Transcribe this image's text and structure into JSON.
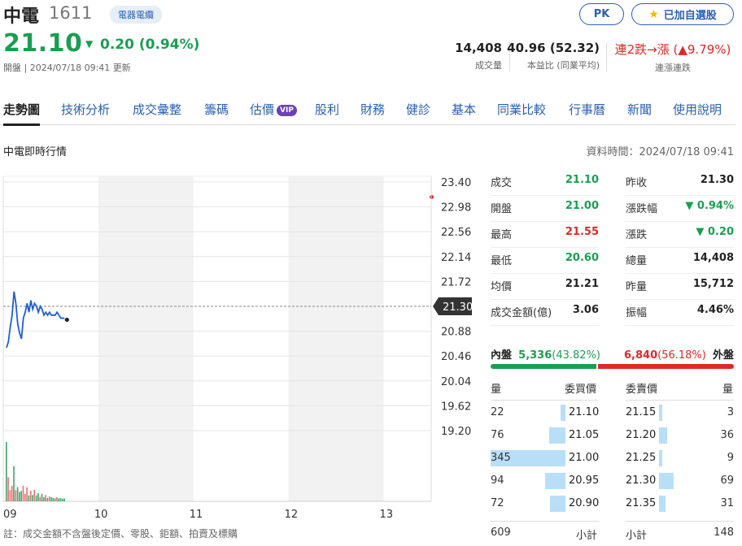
{
  "header": {
    "name": "中電",
    "code": "1611",
    "category": "電器電纜",
    "price": "21.10",
    "change_arrow": "▼",
    "change": "0.20 (0.94%)",
    "status": "開盤 | 2024/07/18 09:41 更新",
    "pk_button": "PK",
    "watchlist_icon": "star-icon",
    "watchlist_button": "已加自選股",
    "stats": [
      {
        "value": "14,408",
        "label": "成交量"
      },
      {
        "value": "40.96 (52.32)",
        "label": "本益比 (同業平均)"
      },
      {
        "value": "連2跌→漲 (▲9.79%)",
        "label": "連漲連跌"
      }
    ]
  },
  "tabs": [
    "走勢圖",
    "技術分析",
    "成交彙整",
    "籌碼",
    "估價",
    "股利",
    "財務",
    "健診",
    "基本",
    "同業比較",
    "行事曆",
    "新聞",
    "使用說明"
  ],
  "vip_badge": "VIP",
  "section": {
    "title": "中電即時行情",
    "data_time": "資料時間：2024/07/18 09:41"
  },
  "chart_data": {
    "type": "line",
    "y_ticks": [
      "23.40",
      "22.98",
      "22.56",
      "22.14",
      "21.72",
      "21.30",
      "20.88",
      "20.46",
      "20.04",
      "19.62",
      "19.20"
    ],
    "x_ticks": [
      "09",
      "10",
      "11",
      "12",
      "13"
    ],
    "ylim": [
      19.2,
      23.4
    ],
    "reference_price": "21.30",
    "last_price_point": 21.1,
    "price_series": [
      20.6,
      20.7,
      20.95,
      21.15,
      21.55,
      21.35,
      21.0,
      20.85,
      20.75,
      21.1,
      21.2,
      21.35,
      21.2,
      21.4,
      21.25,
      21.35,
      21.3,
      21.2,
      21.3,
      21.25,
      21.15,
      21.2,
      21.15,
      21.2,
      21.15,
      21.15,
      21.15,
      21.2,
      21.15,
      21.1,
      21.1,
      21.1
    ],
    "volume_series": [
      1600,
      650,
      300,
      420,
      950,
      300,
      380,
      250,
      280,
      420,
      200,
      380,
      160,
      290,
      170,
      310,
      160,
      220,
      120,
      200,
      110,
      170,
      90,
      130,
      110,
      90,
      80,
      110,
      80,
      90,
      70,
      80
    ],
    "volume_colors_up": [
      false,
      true,
      true,
      true,
      false,
      true,
      false,
      false,
      false,
      true,
      true,
      true,
      false,
      true,
      false,
      true,
      false,
      false,
      true,
      false,
      false,
      true,
      false,
      true,
      false,
      false,
      false,
      true,
      false,
      false,
      false,
      false
    ]
  },
  "quote": {
    "left": [
      {
        "label": "成交",
        "value": "21.10",
        "color": "green"
      },
      {
        "label": "開盤",
        "value": "21.00",
        "color": "green"
      },
      {
        "label": "最高",
        "value": "21.55",
        "color": "red"
      },
      {
        "label": "最低",
        "value": "20.60",
        "color": "green"
      },
      {
        "label": "均價",
        "value": "21.21",
        "color": "dark"
      },
      {
        "label": "成交金額(億)",
        "value": "3.06",
        "color": "dark"
      }
    ],
    "right": [
      {
        "label": "昨收",
        "value": "21.30",
        "color": "dark"
      },
      {
        "label": "漲跌幅",
        "value": "▼ 0.94%",
        "color": "green"
      },
      {
        "label": "漲跌",
        "value": "▼ 0.20",
        "color": "green"
      },
      {
        "label": "總量",
        "value": "14,408",
        "color": "dark"
      },
      {
        "label": "昨量",
        "value": "15,712",
        "color": "dark"
      },
      {
        "label": "振幅",
        "value": "4.46%",
        "color": "dark"
      }
    ]
  },
  "inout": {
    "inner_label": "內盤",
    "inner_value": "5,336",
    "inner_pct": "(43.82%)",
    "outer_value": "6,840",
    "outer_pct": "(56.18%)",
    "outer_label": "外盤",
    "inner_fraction": 0.4382
  },
  "orderbook": {
    "bid_header": [
      "量",
      "委買價"
    ],
    "ask_header": [
      "委賣價",
      "量"
    ],
    "bids": [
      {
        "qty": "22",
        "price": "21.10",
        "level": 22
      },
      {
        "qty": "76",
        "price": "21.05",
        "level": 76
      },
      {
        "qty": "345",
        "price": "21.00",
        "level": 345
      },
      {
        "qty": "94",
        "price": "20.95",
        "level": 94
      },
      {
        "qty": "72",
        "price": "20.90",
        "level": 72
      }
    ],
    "asks": [
      {
        "price": "21.15",
        "qty": "3",
        "level": 3
      },
      {
        "price": "21.20",
        "qty": "36",
        "level": 36
      },
      {
        "price": "21.25",
        "qty": "9",
        "level": 9
      },
      {
        "price": "21.30",
        "qty": "69",
        "level": 69
      },
      {
        "price": "21.35",
        "qty": "31",
        "level": 31
      }
    ],
    "bid_total": "609",
    "subtotal_label": "小計",
    "ask_total": "148",
    "max_level": 345
  },
  "footnote": "註：成交金額不含盤後定價、零股、鉅額、拍賣及標購"
}
